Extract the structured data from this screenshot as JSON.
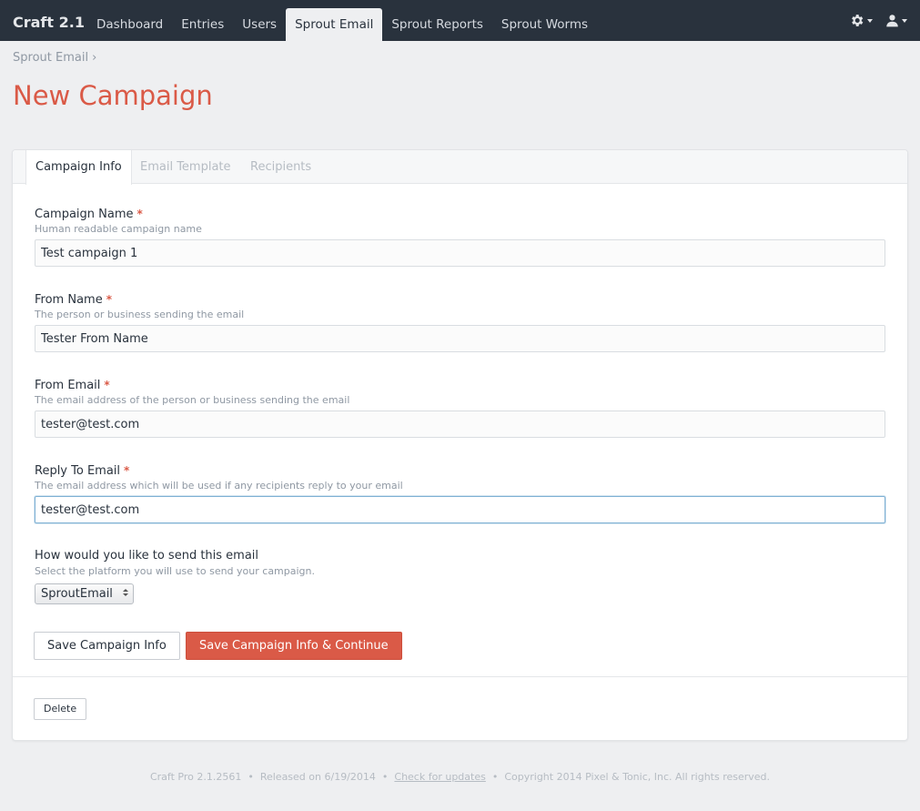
{
  "app": {
    "brand": "Craft 2.1",
    "nav": [
      {
        "label": "Dashboard",
        "active": false
      },
      {
        "label": "Entries",
        "active": false
      },
      {
        "label": "Users",
        "active": false
      },
      {
        "label": "Sprout Email",
        "active": true
      },
      {
        "label": "Sprout Reports",
        "active": false
      },
      {
        "label": "Sprout Worms",
        "active": false
      }
    ],
    "tools": {
      "settings_icon": "gear-icon",
      "user_icon": "user-icon"
    }
  },
  "breadcrumb": {
    "items": [
      "Sprout Email"
    ],
    "separator": "›"
  },
  "page": {
    "title": "New Campaign"
  },
  "tabs": [
    {
      "label": "Campaign Info",
      "active": true
    },
    {
      "label": "Email Template",
      "active": false
    },
    {
      "label": "Recipients",
      "active": false
    }
  ],
  "form": {
    "campaign_name": {
      "label": "Campaign Name",
      "required": true,
      "instructions": "Human readable campaign name",
      "value": "Test campaign 1"
    },
    "from_name": {
      "label": "From Name",
      "required": true,
      "instructions": "The person or business sending the email",
      "value": "Tester From Name"
    },
    "from_email": {
      "label": "From Email",
      "required": true,
      "instructions": "The email address of the person or business sending the email",
      "value": "tester@test.com"
    },
    "reply_to_email": {
      "label": "Reply To Email",
      "required": true,
      "instructions": "The email address which will be used if any recipients reply to your email",
      "value": "tester@test.com"
    },
    "send_method": {
      "label": "How would you like to send this email",
      "instructions": "Select the platform you will use to send your campaign.",
      "selected": "SproutEmail"
    },
    "required_marker": "*",
    "save_label": "Save Campaign Info",
    "save_continue_label": "Save Campaign Info & Continue",
    "delete_label": "Delete"
  },
  "footer": {
    "version": "Craft Pro 2.1.2561",
    "released": "Released on 6/19/2014",
    "check_updates": "Check for updates",
    "copyright": "Copyright 2014 Pixel & Tonic, Inc. All rights reserved.",
    "separator": "•"
  },
  "colors": {
    "accent": "#da5a47",
    "nav_bg": "#29323d",
    "page_bg": "#eeeff1"
  }
}
